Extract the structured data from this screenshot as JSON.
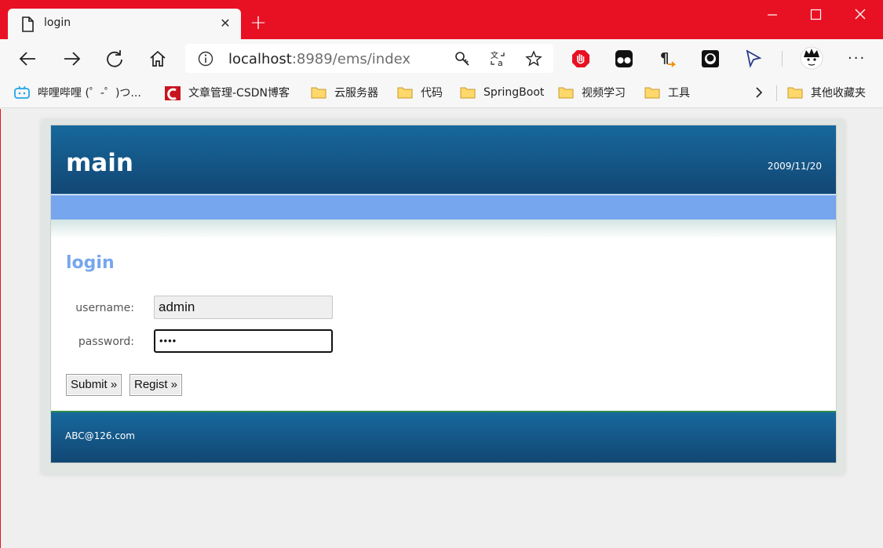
{
  "browser": {
    "tab_title": "login",
    "url_host": "localhost",
    "url_rest": ":8989/ems/index",
    "bookmarks": [
      {
        "label": "哔哩哔哩 (゜-゜)つ..."
      },
      {
        "label": "文章管理-CSDN博客"
      },
      {
        "label": "云服务器"
      },
      {
        "label": "代码"
      },
      {
        "label": "SpringBoot"
      },
      {
        "label": "视频学习"
      },
      {
        "label": "工具"
      }
    ],
    "other_bookmarks": "其他收藏夹",
    "colors": {
      "titlebar": "#e81123",
      "toolbar": "#f7f7f7"
    }
  },
  "page": {
    "site_title": "main",
    "date": "2009/11/20",
    "heading": "login",
    "form": {
      "username_label": "username:",
      "username_value": "admin",
      "password_label": "password:",
      "password_value": "••••",
      "submit_label": "Submit »",
      "regist_label": "Regist »"
    },
    "footer": "ABC@126.com",
    "colors": {
      "header": "#17689c",
      "menubar": "#76a6ee",
      "heading": "#76a6ee"
    }
  }
}
